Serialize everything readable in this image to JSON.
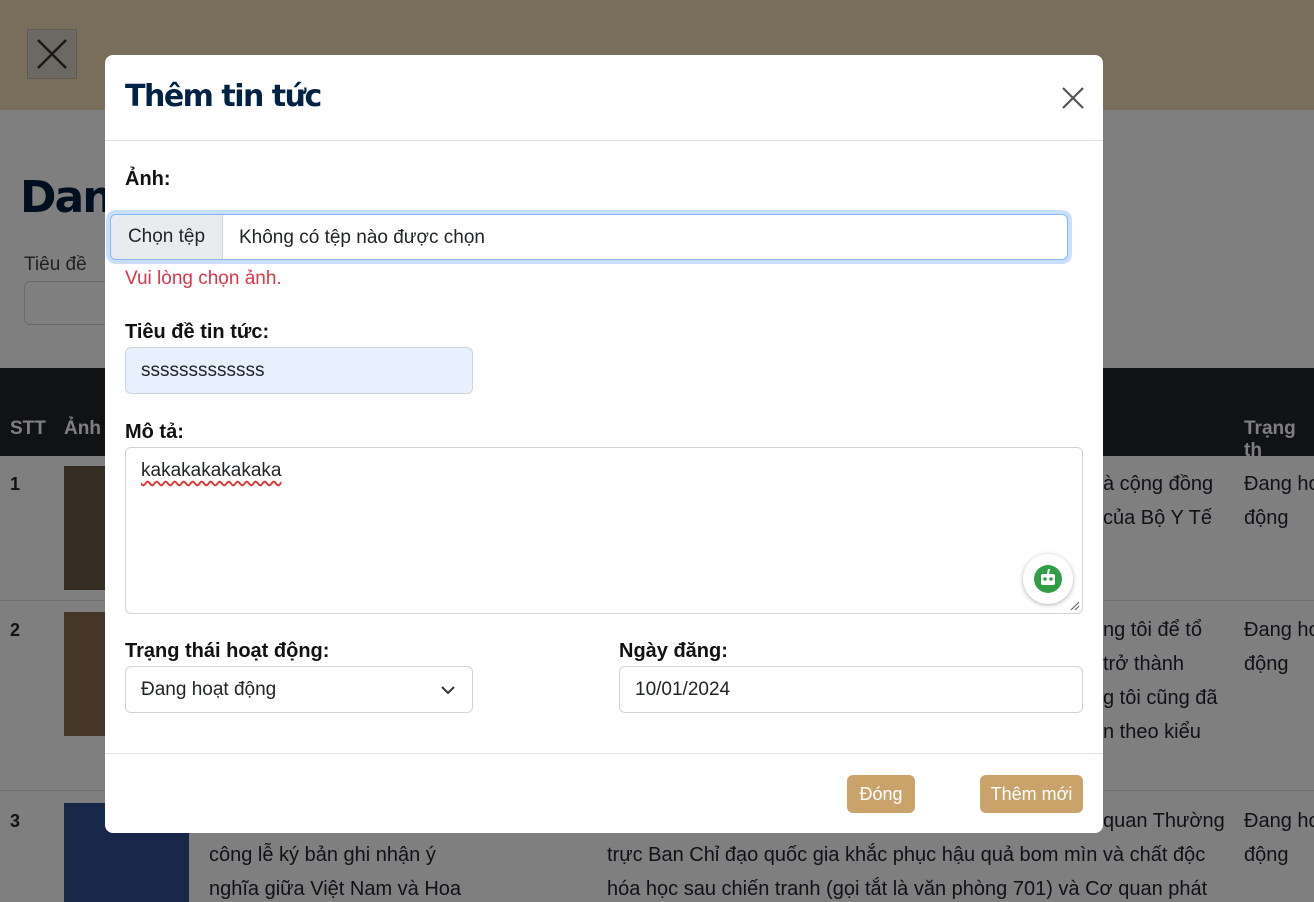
{
  "background": {
    "page_title": "Danh",
    "filter_label": "Tiêu đề",
    "table_headers": {
      "stt": "STT",
      "image": "Ảnh",
      "status": "Trạng th"
    },
    "rows": [
      {
        "stt": "1",
        "snippets": [
          "à cộng đồng",
          "của Bộ Y Tế"
        ],
        "status": [
          "Đang ho",
          "động"
        ]
      },
      {
        "stt": "2",
        "snippets": [
          "ng tôi để tổ",
          "trở thành",
          "g tôi cũng đã",
          "n theo kiểu"
        ],
        "status": [
          "Đang ho",
          "động"
        ]
      },
      {
        "stt": "3",
        "title_lines": [
          "công lễ ký bản ghi nhận ý",
          "nghĩa giữa Việt Nam và Hoa"
        ],
        "snippets": [
          "quan Thường",
          "trực Ban Chỉ đạo quốc gia khắc phục hậu quả bom mìn và chất độc",
          "hóa học sau chiến tranh (gọi tắt là văn phòng 701) và Cơ quan phát"
        ],
        "status": [
          "Đang ho",
          "động"
        ]
      }
    ]
  },
  "modal": {
    "title": "Thêm tin tức",
    "image_label": "Ảnh:",
    "file_button": "Chọn tệp",
    "file_name": "Không có tệp nào được chọn",
    "image_error": "Vui lòng chọn ảnh.",
    "news_title_label": "Tiêu đề tin tức:",
    "news_title_value": "sssssssssssss",
    "description_label": "Mô tả:",
    "description_value": "kakakakakakaka",
    "status_label": "Trạng thái hoạt động:",
    "status_value": "Đang hoạt động",
    "date_label": "Ngày đăng:",
    "date_value": "10/01/2024",
    "close_button": "Đóng",
    "add_button": "Thêm mới"
  },
  "colors": {
    "accent": "#c9a36a",
    "error": "#dc3545",
    "title": "#002244",
    "autofill": "#e8f0fe"
  },
  "icons": {
    "modal_close": "close-icon",
    "nav_toggle": "close-icon",
    "select": "chevron-down-icon",
    "assistant": "robot-icon"
  }
}
